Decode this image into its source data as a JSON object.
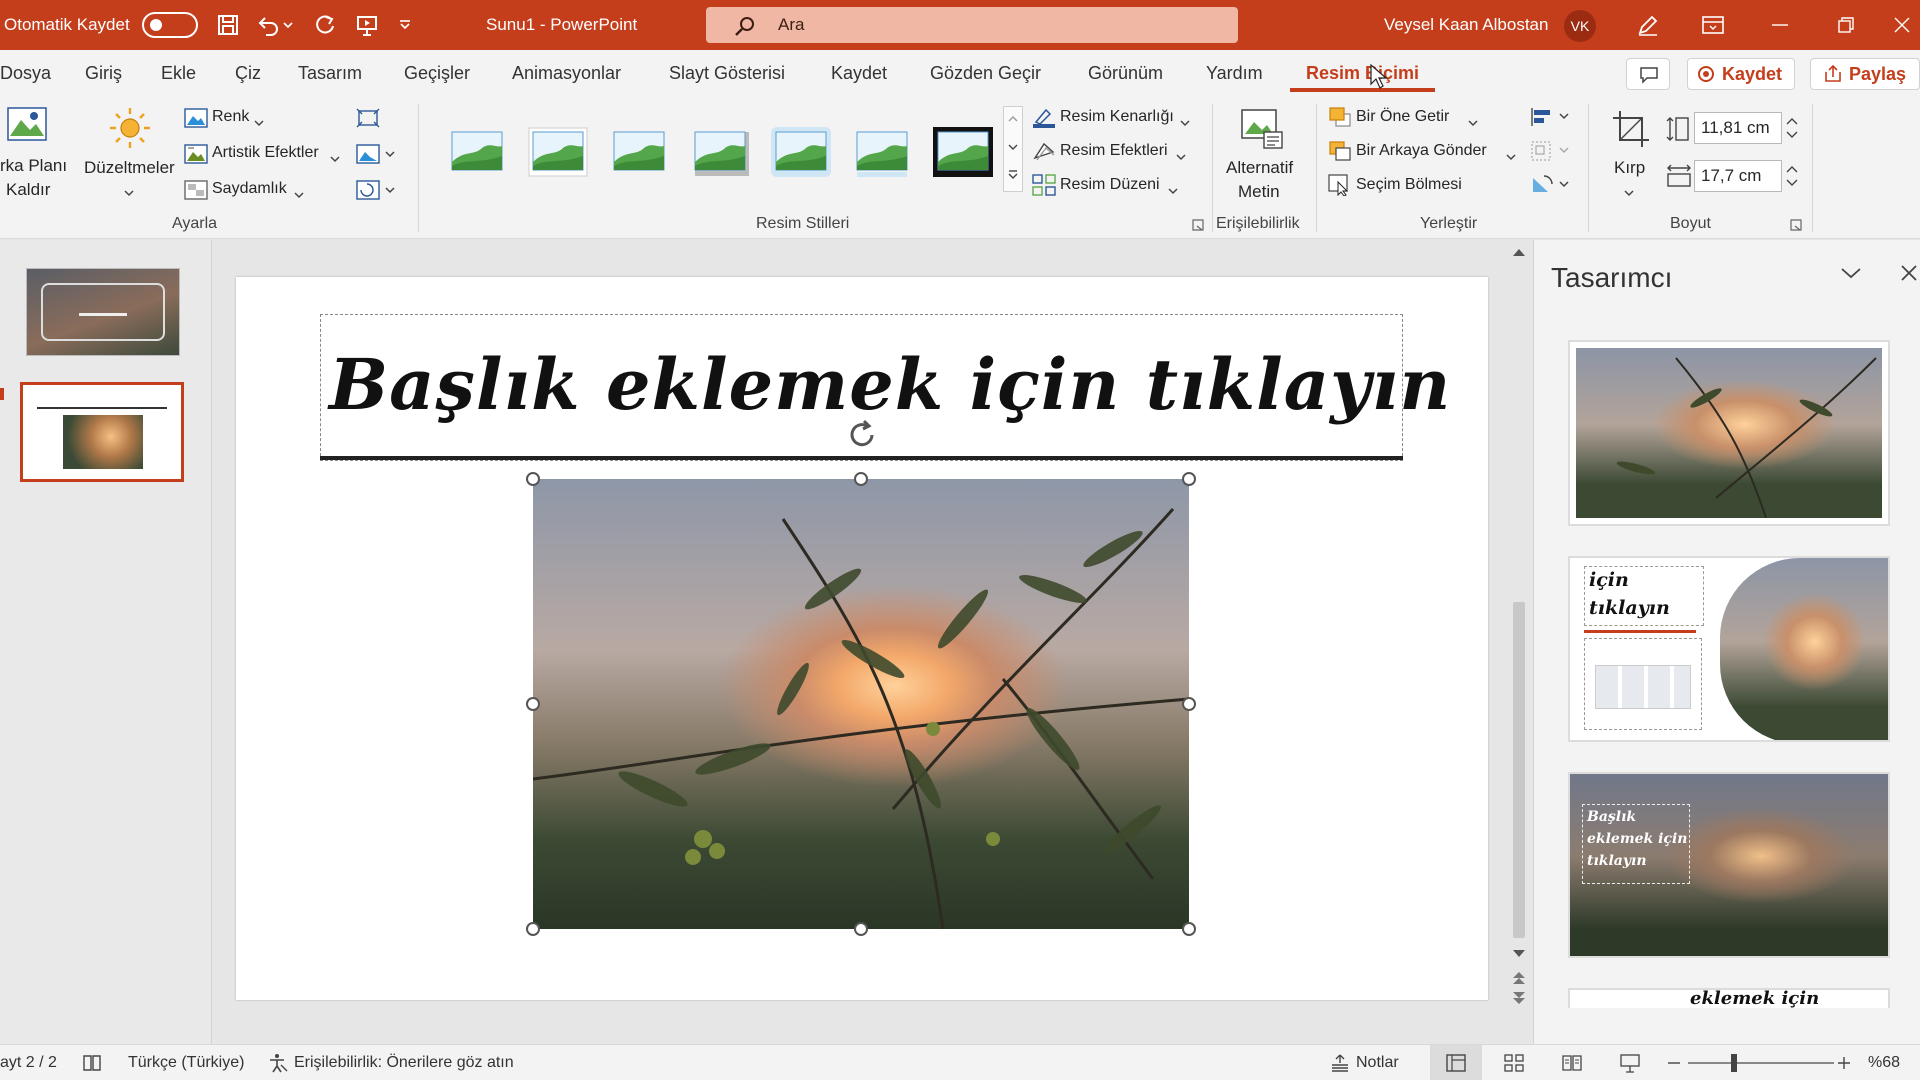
{
  "titlebar": {
    "autosave_label": "Otomatik Kaydet",
    "doc_title": "Sunu1  -  PowerPoint",
    "search_placeholder": "Ara",
    "user_name": "Veysel Kaan Albostan",
    "user_initials": "VK"
  },
  "tabs": [
    "Dosya",
    "Giriş",
    "Ekle",
    "Çiz",
    "Tasarım",
    "Geçişler",
    "Animasyonlar",
    "Slayt Gösterisi",
    "Kaydet",
    "Gözden Geçir",
    "Görünüm",
    "Yardım",
    "Resim Biçimi"
  ],
  "active_tab": "Resim Biçimi",
  "header_buttons": {
    "record": "Kaydet",
    "share": "Paylaş"
  },
  "ribbon": {
    "remove_bg_line1": "rka Planı",
    "remove_bg_line2": "Kaldır",
    "corrections": "Düzeltmeler",
    "color": "Renk",
    "artistic": "Artistik Efektler",
    "transparency": "Saydamlık",
    "group_adjust": "Ayarla",
    "border": "Resim Kenarlığı",
    "effects": "Resim Efektleri",
    "layout": "Resim Düzeni",
    "group_styles": "Resim Stilleri",
    "alt_text_line1": "Alternatif",
    "alt_text_line2": "Metin",
    "group_access": "Erişilebilirlik",
    "bring_forward": "Bir Öne Getir",
    "send_backward": "Bir Arkaya Gönder",
    "selection_pane": "Seçim Bölmesi",
    "group_arrange": "Yerleştir",
    "crop": "Kırp",
    "height": "11,81 cm",
    "width": "17,7 cm",
    "group_size": "Boyut"
  },
  "slide": {
    "title_placeholder": "Başlık eklemek için tıklayın"
  },
  "designer": {
    "title": "Tasarımcı",
    "option2_title_line1": "için",
    "option2_title_line2": "tıklayın",
    "option3_title_line1": "Başlık",
    "option3_title_line2": "eklemek için",
    "option3_title_line3": "tıklayın",
    "option4_fragment": "eklemek için"
  },
  "status": {
    "slide_count": "ayt 2 / 2",
    "language": "Türkçe (Türkiye)",
    "accessibility": "Erişilebilirlik: Önerilere göz atın",
    "notes": "Notlar",
    "zoom": "%68"
  },
  "colors": {
    "accent": "#c43e1c",
    "ribbon_bg": "#f3f3f3"
  }
}
